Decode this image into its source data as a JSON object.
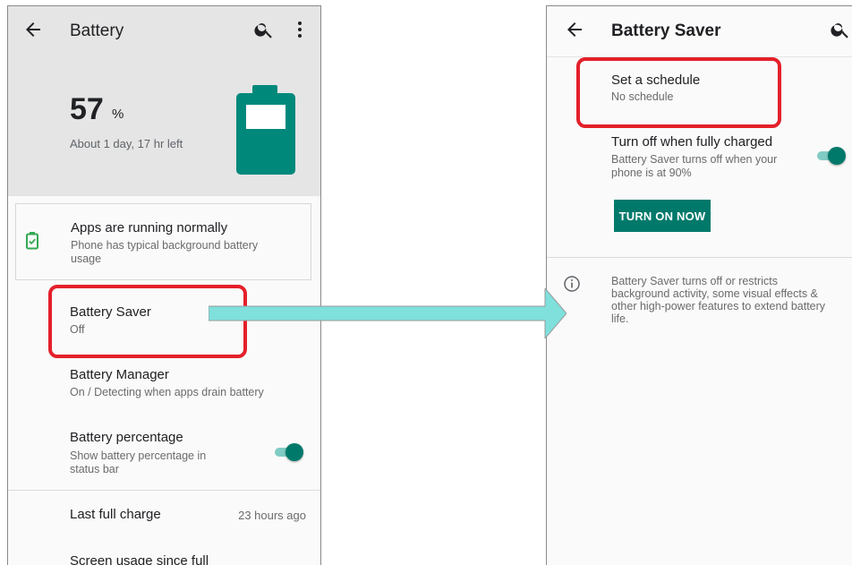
{
  "left": {
    "title": "Battery",
    "battery_level": "57",
    "percent_sign": "%",
    "time_left": "About 1 day, 17 hr left",
    "status_card": {
      "title": "Apps are running normally",
      "subtitle_line1": "Phone has typical background battery",
      "subtitle_line2": "usage"
    },
    "items": [
      {
        "title": "Battery Saver",
        "subtitle": "Off"
      },
      {
        "title": "Battery Manager",
        "subtitle": "On / Detecting when apps drain battery"
      },
      {
        "title": "Battery percentage",
        "subtitle_line1": "Show battery percentage in",
        "subtitle_line2": "status bar",
        "toggle_on": true
      },
      {
        "title": "Last full charge",
        "value": "23 hours ago"
      },
      {
        "title": "Screen usage since full"
      }
    ]
  },
  "right": {
    "title": "Battery Saver",
    "schedule": {
      "title": "Set a schedule",
      "subtitle": "No schedule"
    },
    "turn_off": {
      "title": "Turn off when fully charged",
      "subtitle_line1": "Battery Saver turns off when your",
      "subtitle_line2": "phone is at 90%",
      "toggle_on": true
    },
    "turn_on_button": "TURN ON NOW",
    "info": {
      "line1": "Battery Saver turns off or restricts",
      "line2": "background activity, some visual effects &",
      "line3": "other high-power features to extend battery",
      "line4": "life."
    }
  },
  "colors": {
    "accent": "#00796b",
    "highlight": "#e4202a",
    "arrow": "#7fe0dc"
  }
}
